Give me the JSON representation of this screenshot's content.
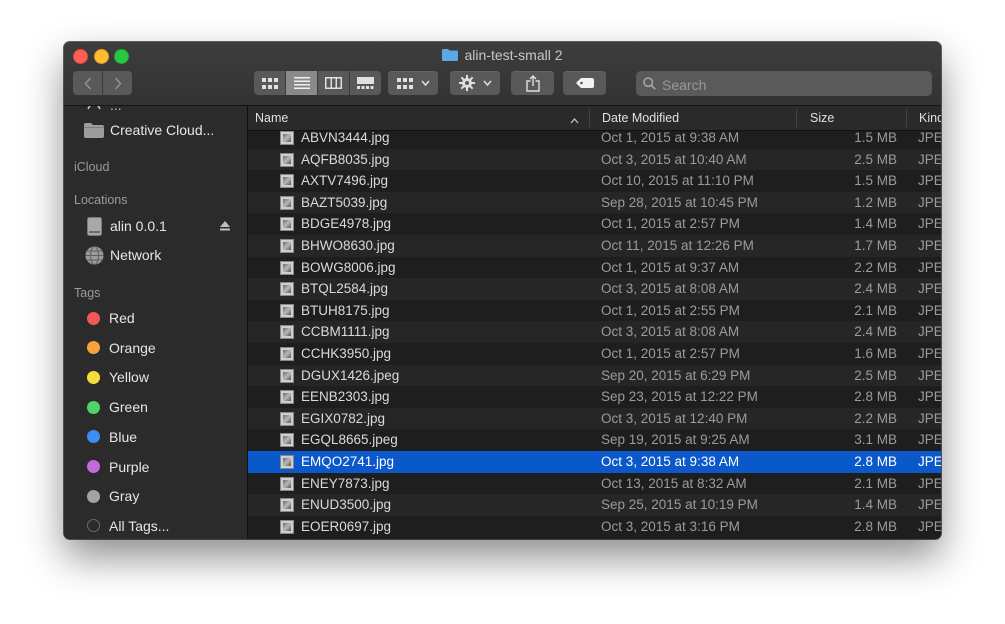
{
  "window": {
    "title": "alin-test-small 2"
  },
  "toolbar": {
    "search_placeholder": "Search",
    "view_buttons": [
      "icon-view",
      "list-view",
      "column-view",
      "gallery-view"
    ],
    "active_view": "list-view"
  },
  "sidebar": {
    "partial_item": "...",
    "creative_cloud": "Creative Cloud...",
    "icloud_header": "iCloud",
    "locations_header": "Locations",
    "locations": [
      "alin 0.0.1",
      "Network"
    ],
    "tags_header": "Tags",
    "tags": [
      {
        "label": "Red",
        "color": "#f25757"
      },
      {
        "label": "Orange",
        "color": "#f7a23b"
      },
      {
        "label": "Yellow",
        "color": "#f5dd3a"
      },
      {
        "label": "Green",
        "color": "#4fd46a"
      },
      {
        "label": "Blue",
        "color": "#3b8ef7"
      },
      {
        "label": "Purple",
        "color": "#c46bd9"
      },
      {
        "label": "Gray",
        "color": "#a3a3a3"
      },
      {
        "label": "All Tags...",
        "color": "#2b2b2b"
      }
    ]
  },
  "columns": {
    "name": "Name",
    "date": "Date Modified",
    "size": "Size",
    "kind": "Kind"
  },
  "files": [
    {
      "name": "ABVN3444.jpg",
      "date": "Oct 1, 2015 at 9:38 AM",
      "size": "1.5 MB",
      "kind": "JPEG"
    },
    {
      "name": "AQFB8035.jpg",
      "date": "Oct 3, 2015 at 10:40 AM",
      "size": "2.5 MB",
      "kind": "JPEG"
    },
    {
      "name": "AXTV7496.jpg",
      "date": "Oct 10, 2015 at 11:10 PM",
      "size": "1.5 MB",
      "kind": "JPEG"
    },
    {
      "name": "BAZT5039.jpg",
      "date": "Sep 28, 2015 at 10:45 PM",
      "size": "1.2 MB",
      "kind": "JPEG"
    },
    {
      "name": "BDGE4978.jpg",
      "date": "Oct 1, 2015 at 2:57 PM",
      "size": "1.4 MB",
      "kind": "JPEG"
    },
    {
      "name": "BHWO8630.jpg",
      "date": "Oct 11, 2015 at 12:26 PM",
      "size": "1.7 MB",
      "kind": "JPEG"
    },
    {
      "name": "BOWG8006.jpg",
      "date": "Oct 1, 2015 at 9:37 AM",
      "size": "2.2 MB",
      "kind": "JPEG"
    },
    {
      "name": "BTQL2584.jpg",
      "date": "Oct 3, 2015 at 8:08 AM",
      "size": "2.4 MB",
      "kind": "JPEG"
    },
    {
      "name": "BTUH8175.jpg",
      "date": "Oct 1, 2015 at 2:55 PM",
      "size": "2.1 MB",
      "kind": "JPEG"
    },
    {
      "name": "CCBM1111.jpg",
      "date": "Oct 3, 2015 at 8:08 AM",
      "size": "2.4 MB",
      "kind": "JPEG"
    },
    {
      "name": "CCHK3950.jpg",
      "date": "Oct 1, 2015 at 2:57 PM",
      "size": "1.6 MB",
      "kind": "JPEG"
    },
    {
      "name": "DGUX1426.jpeg",
      "date": "Sep 20, 2015 at 6:29 PM",
      "size": "2.5 MB",
      "kind": "JPEG"
    },
    {
      "name": "EENB2303.jpg",
      "date": "Sep 23, 2015 at 12:22 PM",
      "size": "2.8 MB",
      "kind": "JPEG"
    },
    {
      "name": "EGIX0782.jpg",
      "date": "Oct 3, 2015 at 12:40 PM",
      "size": "2.2 MB",
      "kind": "JPEG"
    },
    {
      "name": "EGQL8665.jpeg",
      "date": "Sep 19, 2015 at 9:25 AM",
      "size": "3.1 MB",
      "kind": "JPEG"
    },
    {
      "name": "EMQO2741.jpg",
      "date": "Oct 3, 2015 at 9:38 AM",
      "size": "2.8 MB",
      "kind": "JPEG",
      "selected": true
    },
    {
      "name": "ENEY7873.jpg",
      "date": "Oct 13, 2015 at 8:32 AM",
      "size": "2.1 MB",
      "kind": "JPEG"
    },
    {
      "name": "ENUD3500.jpg",
      "date": "Sep 25, 2015 at 10:19 PM",
      "size": "1.4 MB",
      "kind": "JPEG"
    },
    {
      "name": "EOER0697.jpg",
      "date": "Oct 3, 2015 at 3:16 PM",
      "size": "2.8 MB",
      "kind": "JPEG"
    }
  ]
}
